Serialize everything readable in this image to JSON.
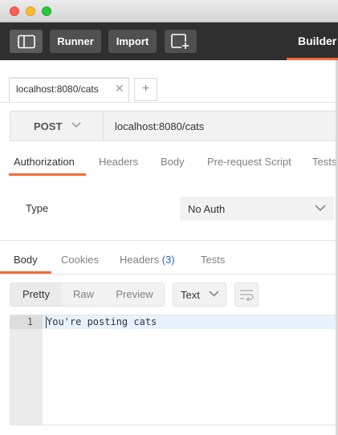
{
  "toolbar": {
    "runner_label": "Runner",
    "import_label": "Import",
    "builder_label": "Builder",
    "icons": {
      "sidebar": "sidebar-toggle-icon",
      "new_tab": "new-window-icon"
    }
  },
  "request_tabs": {
    "active_tab_label": "localhost:8080/cats",
    "close_glyph": "✕",
    "add_glyph": "+"
  },
  "request": {
    "method": "POST",
    "url": "localhost:8080/cats"
  },
  "request_subtabs": [
    {
      "label": "Authorization",
      "active": true
    },
    {
      "label": "Headers",
      "active": false
    },
    {
      "label": "Body",
      "active": false
    },
    {
      "label": "Pre-request Script",
      "active": false
    },
    {
      "label": "Tests",
      "active": false
    }
  ],
  "auth": {
    "type_label": "Type",
    "selected": "No Auth"
  },
  "response_tabs": {
    "body": "Body",
    "cookies": "Cookies",
    "headers": "Headers",
    "headers_count": "(3)",
    "tests": "Tests"
  },
  "response_view": {
    "pretty": "Pretty",
    "raw": "Raw",
    "preview": "Preview",
    "format": "Text"
  },
  "response_body": {
    "lines": [
      {
        "number": "1",
        "text": "You're posting cats"
      }
    ]
  },
  "colors": {
    "accent": "#f26b3a",
    "toolbar_bg": "#2f2f2f",
    "toolbar_button": "#505050",
    "headers_count": "#2a6ec6"
  }
}
